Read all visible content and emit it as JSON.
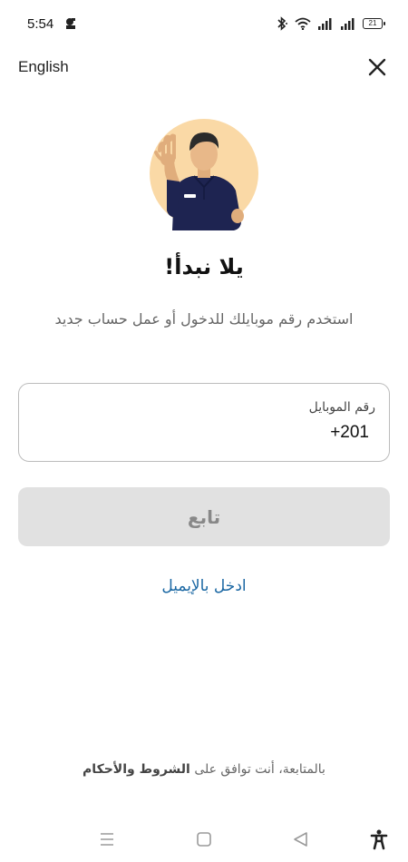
{
  "status_bar": {
    "time": "5:54",
    "battery_level": "21",
    "icons": [
      "app-notification-icon",
      "bluetooth-icon",
      "wifi-icon",
      "signal-icon",
      "signal-icon",
      "battery-icon"
    ]
  },
  "header": {
    "language_label": "English",
    "close_icon": "close-icon"
  },
  "illustration": {
    "icon": "waving-person-illustration",
    "bg_color": "#fad9a6",
    "shirt_color": "#1e2451"
  },
  "main": {
    "headline": "يلا نبدأ!",
    "subtitle": "استخدم رقم موبايلك للدخول أو عمل حساب جديد",
    "phone_field": {
      "label": "رقم الموبايل",
      "value": "+201"
    },
    "continue_label": "تابع",
    "email_login_label": "ادخل بالإيميل"
  },
  "footer": {
    "terms_prefix": "بالمتابعة، أنت توافق على",
    "terms_link": "الشروط والأحكام"
  },
  "nav_bar": {
    "icons": [
      "menu-icon",
      "home-square-icon",
      "back-triangle-icon",
      "accessibility-icon"
    ]
  },
  "colors": {
    "link_blue": "#1a67a3",
    "button_disabled_bg": "#e1e1e1",
    "button_disabled_text": "#888888"
  }
}
